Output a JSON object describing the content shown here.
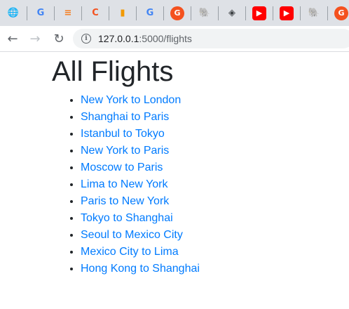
{
  "browser": {
    "url_host": "127.0.0.1",
    "url_path": ":5000/flights",
    "tabs": [
      {
        "icon": "globe-icon",
        "glyph": "🌐",
        "color": "#5f6368"
      },
      {
        "icon": "google-icon",
        "glyph": "G",
        "color": "#4285f4"
      },
      {
        "icon": "stackoverflow-icon",
        "glyph": "≡",
        "color": "#f48024"
      },
      {
        "icon": "orange-c-icon",
        "glyph": "C",
        "color": "#f4511e"
      },
      {
        "icon": "book-icon",
        "glyph": "▮",
        "color": "#f29900"
      },
      {
        "icon": "google-icon",
        "glyph": "G",
        "color": "#4285f4"
      },
      {
        "icon": "g-orange-icon",
        "glyph": "G",
        "color": "#ffffff",
        "bg": "#f4511e"
      },
      {
        "icon": "postgres-elephant-icon",
        "glyph": "🐘",
        "color": "#336791"
      },
      {
        "icon": "diamond-icon",
        "glyph": "◈",
        "color": "#3c4043"
      },
      {
        "icon": "youtube-icon",
        "glyph": "▶",
        "color": "#ffffff",
        "bg": "#ff0000"
      },
      {
        "icon": "youtube-icon",
        "glyph": "▶",
        "color": "#ffffff",
        "bg": "#ff0000"
      },
      {
        "icon": "postgres-elephant-icon",
        "glyph": "🐘",
        "color": "#336791"
      },
      {
        "icon": "g-orange-icon",
        "glyph": "G",
        "color": "#ffffff",
        "bg": "#f4511e"
      }
    ]
  },
  "page": {
    "title": "All Flights",
    "flights": [
      "New York to London",
      "Shanghai to Paris",
      "Istanbul to Tokyo",
      "New York to Paris",
      "Moscow to Paris",
      "Lima to New York",
      "Paris to New York",
      "Tokyo to Shanghai",
      "Seoul to Mexico City",
      "Mexico City to Lima",
      "Hong Kong to Shanghai"
    ]
  },
  "colors": {
    "link": "#007bff",
    "heading": "#212529",
    "tabstrip_bg": "#dee1e6"
  }
}
